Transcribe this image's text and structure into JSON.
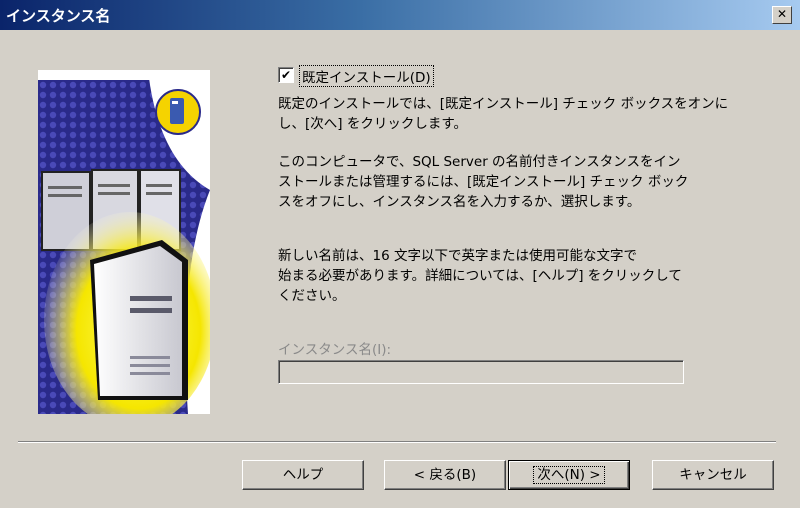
{
  "window": {
    "title": "インスタンス名",
    "close_glyph": "✕"
  },
  "checkbox": {
    "checked": true,
    "check_glyph": "✔",
    "label": "既定インストール(D)"
  },
  "paragraphs": [
    "既定のインストールでは、[既定インストール] チェック ボックスをオンに\nし、[次へ] をクリックします。",
    "このコンピュータで、SQL Server の名前付きインスタンスをイン\nストールまたは管理するには、[既定インストール] チェック ボック\nスをオフにし、インスタンス名を入力するか、選択します。",
    "新しい名前は、16 文字以下で英字または使用可能な文字で\n始まる必要があります。詳細については、[ヘルプ] をクリックして\nください。"
  ],
  "instance": {
    "label": "インスタンス名(I):",
    "value": ""
  },
  "buttons": {
    "help": "ヘルプ",
    "back": "< 戻る(B)",
    "next": "次へ(N) >",
    "cancel": "キャンセル"
  },
  "colors": {
    "dialog_bg": "#d4d0c8",
    "title_start": "#0a246a",
    "title_end": "#a6caf0",
    "disabled_text": "#8a8a8a",
    "server_glow": "#f5e600"
  }
}
